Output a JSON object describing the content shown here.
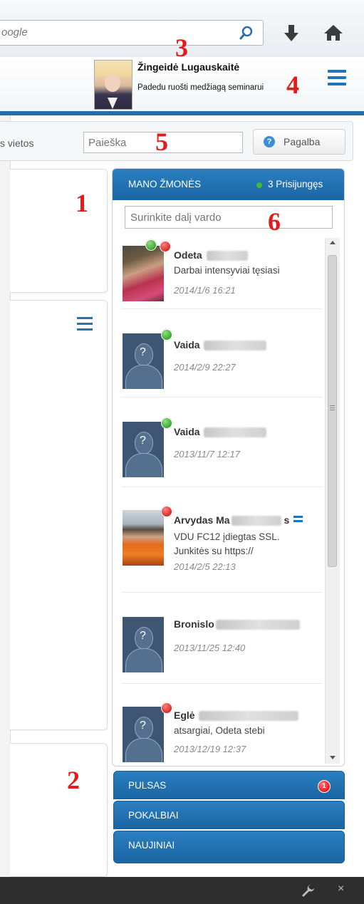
{
  "browser": {
    "url_text": "oogle"
  },
  "profile": {
    "name": "Žingeidė Lugauskaitė",
    "status": "Padedu ruošti medžiagą seminarui"
  },
  "links": {
    "places": "s vietos",
    "search_placeholder": "Paieška",
    "help_label": "Pagalba",
    "help_icon_glyph": "?"
  },
  "people": {
    "title": "MANO ŽMONĖS",
    "online": "3 Prisijungęs",
    "filter_placeholder": "Surinkite dalį vardo",
    "items": [
      {
        "name": "Odeta",
        "message": "Darbai intensyviai tęsiasi",
        "date": "2014/1/6 16:21"
      },
      {
        "name": "Vaida",
        "message": "",
        "date": "2014/2/9 22:27"
      },
      {
        "name": "Vaida",
        "message": "",
        "date": "2013/11/7 12:17"
      },
      {
        "name": "Arvydas Ma",
        "name_tail": "s",
        "message": "VDU FC12 įdiegtas SSL. Junkitės su https://",
        "date": "2014/2/5 22:13"
      },
      {
        "name": "Bronislo",
        "message": "",
        "date": "2013/11/25 12:40"
      },
      {
        "name": "Eglė",
        "message": "atsargiai, Odeta stebi",
        "date": "2013/12/19 12:37"
      }
    ],
    "placeholder_glyph": "?"
  },
  "tabs": [
    {
      "label": "PULSAS",
      "badge": "1"
    },
    {
      "label": "POKALBIAI"
    },
    {
      "label": "NAUJINIAI"
    }
  ],
  "annotations": [
    "1",
    "2",
    "3",
    "4",
    "5",
    "6"
  ],
  "colors": {
    "accent_blue": "#1f6fae",
    "online_green": "#42b83c",
    "alert_red": "#d00000",
    "annotation_red": "#e31b1b"
  }
}
